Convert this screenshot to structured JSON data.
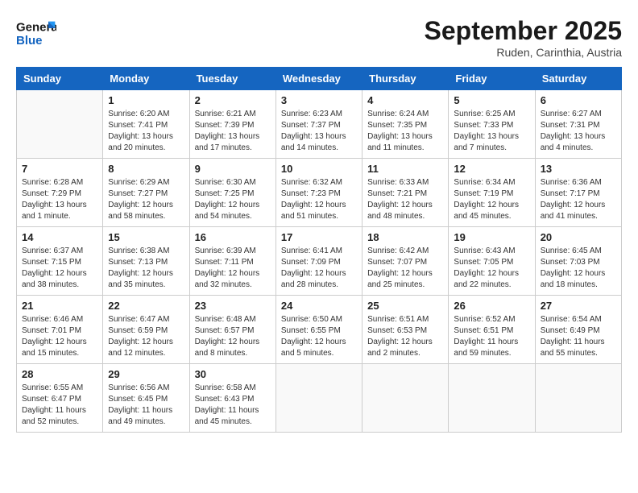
{
  "header": {
    "logo_line1": "General",
    "logo_line2": "Blue",
    "month": "September 2025",
    "location": "Ruden, Carinthia, Austria"
  },
  "weekdays": [
    "Sunday",
    "Monday",
    "Tuesday",
    "Wednesday",
    "Thursday",
    "Friday",
    "Saturday"
  ],
  "weeks": [
    [
      {
        "day": "",
        "empty": true
      },
      {
        "day": "1",
        "sunrise": "Sunrise: 6:20 AM",
        "sunset": "Sunset: 7:41 PM",
        "daylight": "Daylight: 13 hours and 20 minutes."
      },
      {
        "day": "2",
        "sunrise": "Sunrise: 6:21 AM",
        "sunset": "Sunset: 7:39 PM",
        "daylight": "Daylight: 13 hours and 17 minutes."
      },
      {
        "day": "3",
        "sunrise": "Sunrise: 6:23 AM",
        "sunset": "Sunset: 7:37 PM",
        "daylight": "Daylight: 13 hours and 14 minutes."
      },
      {
        "day": "4",
        "sunrise": "Sunrise: 6:24 AM",
        "sunset": "Sunset: 7:35 PM",
        "daylight": "Daylight: 13 hours and 11 minutes."
      },
      {
        "day": "5",
        "sunrise": "Sunrise: 6:25 AM",
        "sunset": "Sunset: 7:33 PM",
        "daylight": "Daylight: 13 hours and 7 minutes."
      },
      {
        "day": "6",
        "sunrise": "Sunrise: 6:27 AM",
        "sunset": "Sunset: 7:31 PM",
        "daylight": "Daylight: 13 hours and 4 minutes."
      }
    ],
    [
      {
        "day": "7",
        "sunrise": "Sunrise: 6:28 AM",
        "sunset": "Sunset: 7:29 PM",
        "daylight": "Daylight: 13 hours and 1 minute."
      },
      {
        "day": "8",
        "sunrise": "Sunrise: 6:29 AM",
        "sunset": "Sunset: 7:27 PM",
        "daylight": "Daylight: 12 hours and 58 minutes."
      },
      {
        "day": "9",
        "sunrise": "Sunrise: 6:30 AM",
        "sunset": "Sunset: 7:25 PM",
        "daylight": "Daylight: 12 hours and 54 minutes."
      },
      {
        "day": "10",
        "sunrise": "Sunrise: 6:32 AM",
        "sunset": "Sunset: 7:23 PM",
        "daylight": "Daylight: 12 hours and 51 minutes."
      },
      {
        "day": "11",
        "sunrise": "Sunrise: 6:33 AM",
        "sunset": "Sunset: 7:21 PM",
        "daylight": "Daylight: 12 hours and 48 minutes."
      },
      {
        "day": "12",
        "sunrise": "Sunrise: 6:34 AM",
        "sunset": "Sunset: 7:19 PM",
        "daylight": "Daylight: 12 hours and 45 minutes."
      },
      {
        "day": "13",
        "sunrise": "Sunrise: 6:36 AM",
        "sunset": "Sunset: 7:17 PM",
        "daylight": "Daylight: 12 hours and 41 minutes."
      }
    ],
    [
      {
        "day": "14",
        "sunrise": "Sunrise: 6:37 AM",
        "sunset": "Sunset: 7:15 PM",
        "daylight": "Daylight: 12 hours and 38 minutes."
      },
      {
        "day": "15",
        "sunrise": "Sunrise: 6:38 AM",
        "sunset": "Sunset: 7:13 PM",
        "daylight": "Daylight: 12 hours and 35 minutes."
      },
      {
        "day": "16",
        "sunrise": "Sunrise: 6:39 AM",
        "sunset": "Sunset: 7:11 PM",
        "daylight": "Daylight: 12 hours and 32 minutes."
      },
      {
        "day": "17",
        "sunrise": "Sunrise: 6:41 AM",
        "sunset": "Sunset: 7:09 PM",
        "daylight": "Daylight: 12 hours and 28 minutes."
      },
      {
        "day": "18",
        "sunrise": "Sunrise: 6:42 AM",
        "sunset": "Sunset: 7:07 PM",
        "daylight": "Daylight: 12 hours and 25 minutes."
      },
      {
        "day": "19",
        "sunrise": "Sunrise: 6:43 AM",
        "sunset": "Sunset: 7:05 PM",
        "daylight": "Daylight: 12 hours and 22 minutes."
      },
      {
        "day": "20",
        "sunrise": "Sunrise: 6:45 AM",
        "sunset": "Sunset: 7:03 PM",
        "daylight": "Daylight: 12 hours and 18 minutes."
      }
    ],
    [
      {
        "day": "21",
        "sunrise": "Sunrise: 6:46 AM",
        "sunset": "Sunset: 7:01 PM",
        "daylight": "Daylight: 12 hours and 15 minutes."
      },
      {
        "day": "22",
        "sunrise": "Sunrise: 6:47 AM",
        "sunset": "Sunset: 6:59 PM",
        "daylight": "Daylight: 12 hours and 12 minutes."
      },
      {
        "day": "23",
        "sunrise": "Sunrise: 6:48 AM",
        "sunset": "Sunset: 6:57 PM",
        "daylight": "Daylight: 12 hours and 8 minutes."
      },
      {
        "day": "24",
        "sunrise": "Sunrise: 6:50 AM",
        "sunset": "Sunset: 6:55 PM",
        "daylight": "Daylight: 12 hours and 5 minutes."
      },
      {
        "day": "25",
        "sunrise": "Sunrise: 6:51 AM",
        "sunset": "Sunset: 6:53 PM",
        "daylight": "Daylight: 12 hours and 2 minutes."
      },
      {
        "day": "26",
        "sunrise": "Sunrise: 6:52 AM",
        "sunset": "Sunset: 6:51 PM",
        "daylight": "Daylight: 11 hours and 59 minutes."
      },
      {
        "day": "27",
        "sunrise": "Sunrise: 6:54 AM",
        "sunset": "Sunset: 6:49 PM",
        "daylight": "Daylight: 11 hours and 55 minutes."
      }
    ],
    [
      {
        "day": "28",
        "sunrise": "Sunrise: 6:55 AM",
        "sunset": "Sunset: 6:47 PM",
        "daylight": "Daylight: 11 hours and 52 minutes."
      },
      {
        "day": "29",
        "sunrise": "Sunrise: 6:56 AM",
        "sunset": "Sunset: 6:45 PM",
        "daylight": "Daylight: 11 hours and 49 minutes."
      },
      {
        "day": "30",
        "sunrise": "Sunrise: 6:58 AM",
        "sunset": "Sunset: 6:43 PM",
        "daylight": "Daylight: 11 hours and 45 minutes."
      },
      {
        "day": "",
        "empty": true
      },
      {
        "day": "",
        "empty": true
      },
      {
        "day": "",
        "empty": true
      },
      {
        "day": "",
        "empty": true
      }
    ]
  ]
}
